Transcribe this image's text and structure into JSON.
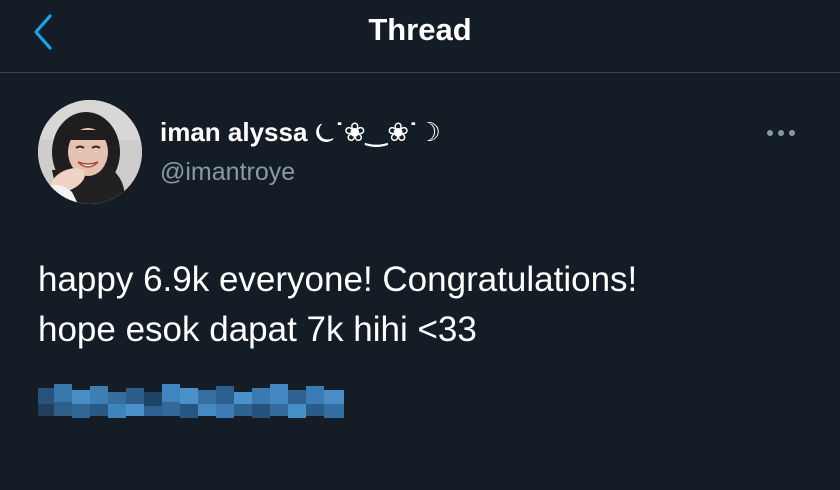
{
  "header": {
    "back_icon": "chevron-left-icon",
    "title": "Thread",
    "accent_color": "#1da1f2"
  },
  "tweet": {
    "author": {
      "display_name": "iman alyssa ⏾˙❀‿❀˙☽",
      "handle": "@imantroye"
    },
    "more_icon": "ellipsis-icon",
    "text_lines": [
      "happy 6.9k everyone! Congratulations!",
      "hope esok dapat 7k hihi <33"
    ],
    "blurred_link": "pixelated-censored-text"
  },
  "colors": {
    "background": "#141d26",
    "divider": "#3a444c",
    "secondary_text": "#8899a6"
  }
}
